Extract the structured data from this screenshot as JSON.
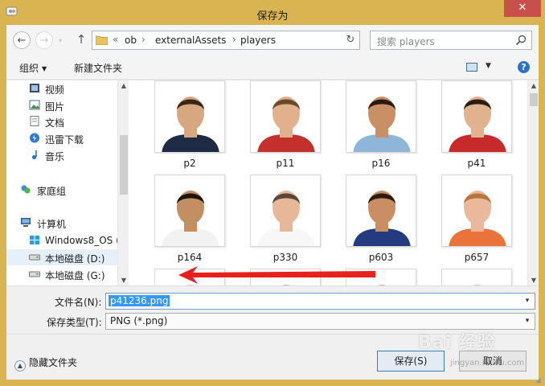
{
  "window": {
    "title": "保存为",
    "close_glyph": "✕"
  },
  "nav": {
    "back_glyph": "←",
    "forward_glyph": "→",
    "up_glyph": "↑",
    "breadcrumb_overflow": "«",
    "breadcrumbs": [
      "ob",
      "externalAssets",
      "players"
    ],
    "refresh_glyph": "↻",
    "search_placeholder": "搜索 players"
  },
  "toolbar": {
    "organize_label": "组织",
    "new_folder_label": "新建文件夹",
    "help_glyph": "?"
  },
  "nav_pane": {
    "items": [
      {
        "label": "视频",
        "icon": "video-icon"
      },
      {
        "label": "图片",
        "icon": "pictures-icon"
      },
      {
        "label": "文档",
        "icon": "documents-icon"
      },
      {
        "label": "迅雷下载",
        "icon": "thunder-download-icon"
      },
      {
        "label": "音乐",
        "icon": "music-icon"
      },
      {
        "label": "家庭组",
        "icon": "homegroup-icon"
      },
      {
        "label": "计算机",
        "icon": "computer-icon"
      },
      {
        "label": "Windows8_OS (",
        "icon": "windows-drive-icon"
      },
      {
        "label": "本地磁盘 (D:)",
        "icon": "drive-icon",
        "selected": true
      },
      {
        "label": "本地磁盘 (G:)",
        "icon": "drive-icon"
      }
    ]
  },
  "files": [
    {
      "name": "p2",
      "shirt": "#1f2a44",
      "skin": "#d7a77f",
      "hair": "#3a2618"
    },
    {
      "name": "p11",
      "shirt": "#c4302b",
      "skin": "#e1b08c",
      "hair": "#6b4a2a"
    },
    {
      "name": "p16",
      "shirt": "#8fb6d8",
      "skin": "#c99066",
      "hair": "#2a1a10"
    },
    {
      "name": "p41",
      "shirt": "#c62a2a",
      "skin": "#e0b28d",
      "hair": "#2b1d14"
    },
    {
      "name": "p164",
      "shirt": "#f2f2f2",
      "skin": "#c48e63",
      "hair": "#1d140d"
    },
    {
      "name": "p330",
      "shirt": "#f7f7f7",
      "skin": "#e6b898",
      "hair": "#5a4636"
    },
    {
      "name": "p603",
      "shirt": "#243b80",
      "skin": "#c98e62",
      "hair": "#2a1a10"
    },
    {
      "name": "p657",
      "shirt": "#e9733a",
      "skin": "#eab89a",
      "hair": "#b5763b"
    },
    {
      "name": "",
      "shirt": "#ffffff",
      "skin": "#e7c3a6",
      "hair": "#ffffff"
    },
    {
      "name": "",
      "shirt": "#ffffff",
      "skin": "#d9a985",
      "hair": "#3b2a1e"
    },
    {
      "name": "",
      "shirt": "#ffffff",
      "skin": "#d9a985",
      "hair": "#2a1a10"
    },
    {
      "name": "",
      "shirt": "#ffffff",
      "skin": "#e2b796",
      "hair": "#4a3424"
    }
  ],
  "form": {
    "filename_label": "文件名(N):",
    "filename_value": "p41236.png",
    "filetype_label": "保存类型(T):",
    "filetype_value": "PNG (*.png)"
  },
  "footer": {
    "hide_folders_label": "隐藏文件夹",
    "save_label": "保存(S)",
    "cancel_label": "取消"
  },
  "watermark": {
    "text": "Bai 经验",
    "sub": "jingyan.baidu.com"
  },
  "colors": {
    "frame": "#d9b451",
    "close": "#c7504b",
    "selection": "#3399ff",
    "arrow": "#e8201b"
  }
}
